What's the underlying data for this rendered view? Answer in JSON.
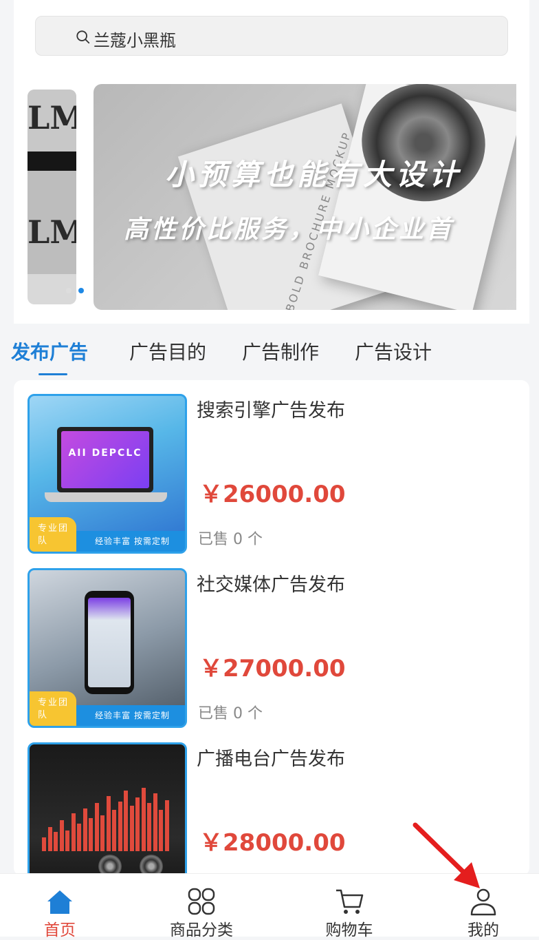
{
  "search": {
    "placeholder": "兰蔻小黑瓶"
  },
  "banner": {
    "title": "小预算也能有大设计",
    "subtitle": "高性价比服务，中小企业首",
    "peek_text": "LM",
    "book_text": "BOLD BROCHURE MOCKUP"
  },
  "category_tabs": [
    {
      "label": "发布广告",
      "active": true
    },
    {
      "label": "广告目的",
      "active": false
    },
    {
      "label": "广告制作",
      "active": false
    },
    {
      "label": "广告设计",
      "active": false
    }
  ],
  "products": [
    {
      "title": "搜索引擎广告发布",
      "price": "￥26000.00",
      "sold": "已售 0 个",
      "badge": "专业团队",
      "ribbon": "经验丰富 按需定制",
      "screen_text": "AII DEPCLC"
    },
    {
      "title": "社交媒体广告发布",
      "price": "￥27000.00",
      "sold": "已售 0 个",
      "badge": "专业团队",
      "ribbon": "经验丰富 按需定制"
    },
    {
      "title": "广播电台广告发布",
      "price": "￥28000.00",
      "sold": "",
      "badge": "",
      "ribbon": ""
    }
  ],
  "tabbar": [
    {
      "label": "首页",
      "icon": "home-icon",
      "active": true
    },
    {
      "label": "商品分类",
      "icon": "category-grid-icon",
      "active": false
    },
    {
      "label": "购物车",
      "icon": "shopping-cart-icon",
      "active": false
    },
    {
      "label": "我的",
      "icon": "user-profile-icon",
      "active": false
    }
  ],
  "colors": {
    "accent": "#1e7fd6",
    "price": "#e0483b",
    "tabbar_active": "#e0483b",
    "annotation_arrow": "#e41e1e"
  }
}
